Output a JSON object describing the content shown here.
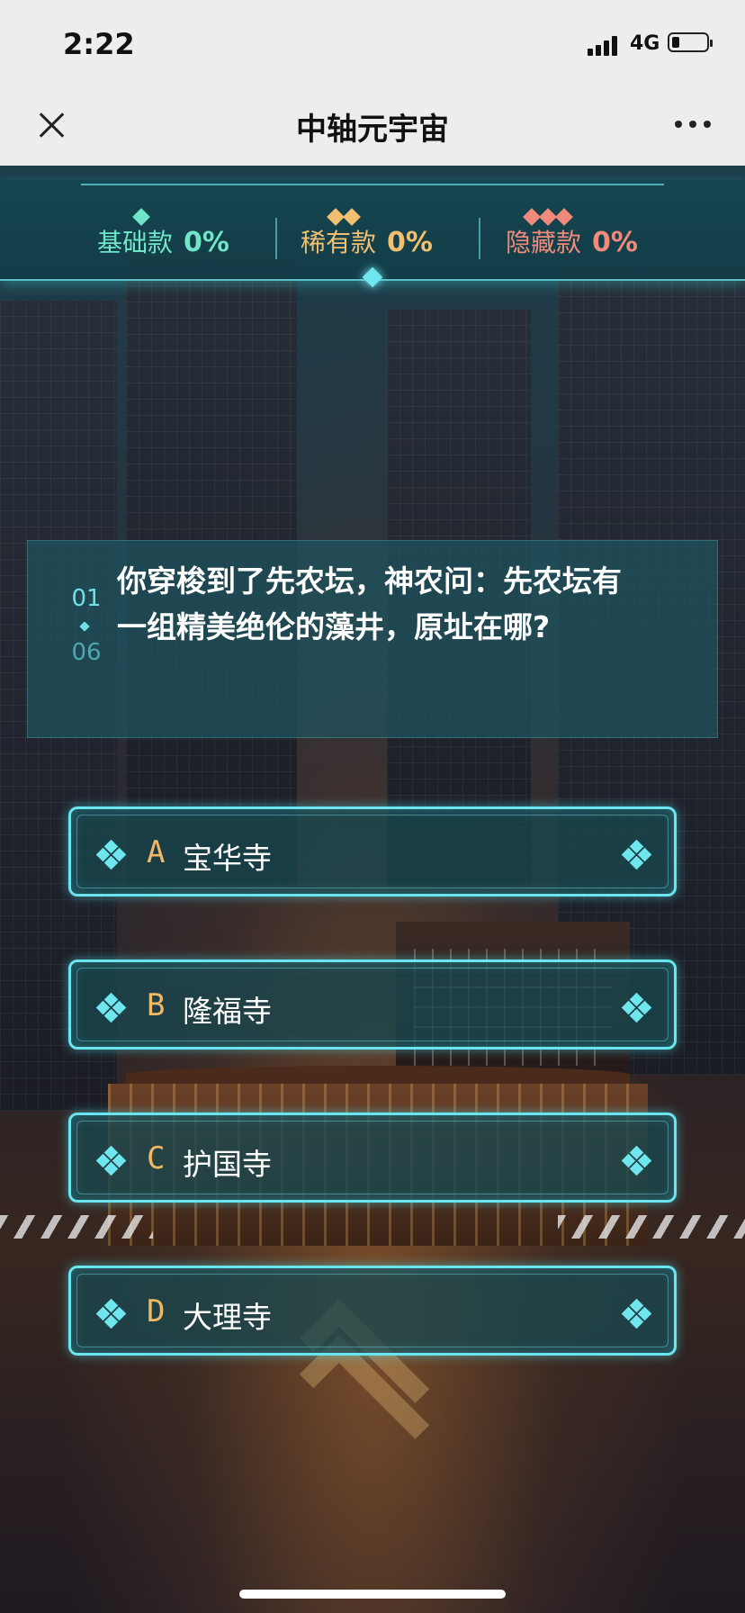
{
  "status_bar": {
    "time": "2:22",
    "network": "4G"
  },
  "nav": {
    "title": "中轴元宇宙"
  },
  "counters": [
    {
      "label": "基础款",
      "value": "0%",
      "color": "#6fe6c8"
    },
    {
      "label": "稀有款",
      "value": "0%",
      "color": "#f0c070"
    },
    {
      "label": "隐藏款",
      "value": "0%",
      "color": "#f08a7a"
    }
  ],
  "question": {
    "current": "01",
    "total": "06",
    "text": "你穿梭到了先农坛，神农问：先农坛有一组精美绝伦的藻井，原址在哪?"
  },
  "options": [
    {
      "letter": "A",
      "text": "宝华寺"
    },
    {
      "letter": "B",
      "text": "隆福寺"
    },
    {
      "letter": "C",
      "text": "护国寺"
    },
    {
      "letter": "D",
      "text": "大理寺"
    }
  ],
  "colors": {
    "accent": "#6ae4ee",
    "letter": "#f2b866"
  }
}
